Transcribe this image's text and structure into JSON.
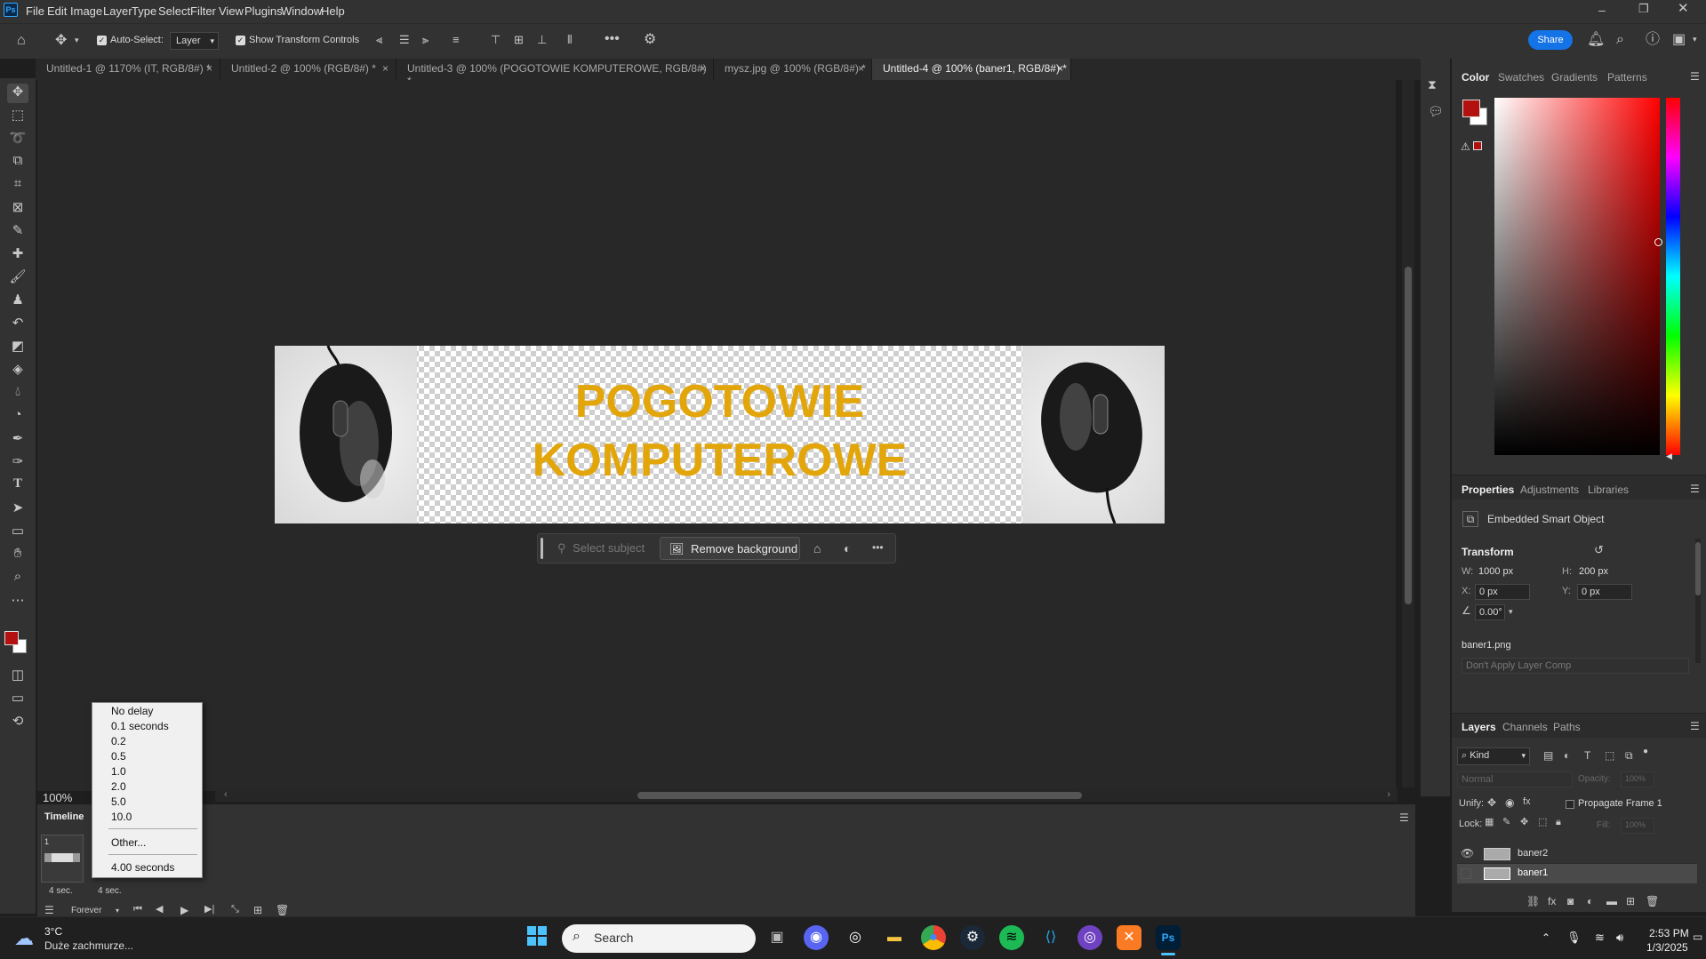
{
  "menu": {
    "ps_logo": "Ps",
    "items": [
      "File",
      "Edit",
      "Image",
      "Layer",
      "Type",
      "Select",
      "Filter",
      "View",
      "Plugins",
      "Window",
      "Help"
    ]
  },
  "options_bar": {
    "auto_select_label": "Auto-Select:",
    "auto_select_value": "Layer",
    "transform_controls_label": "Show Transform Controls",
    "share_label": "Share"
  },
  "tabs": [
    "Untitled-1 @ 1170% (IT, RGB/8#) *",
    "Untitled-2 @ 100% (RGB/8#) *",
    "Untitled-3 @ 100% (POGOTOWIE KOMPUTEROWE, RGB/8#) *",
    "mysz.jpg @ 100% (RGB/8#) *",
    "Untitled-4 @ 100% (baner1, RGB/8#) *"
  ],
  "canvas": {
    "banner_line1": "POGOTOWIE",
    "banner_line2": "KOMPUTEROWE",
    "zoom": "100%"
  },
  "contextual_bar": {
    "select_subject": "Select subject",
    "remove_background": "Remove background"
  },
  "color_panel": {
    "tabs": [
      "Color",
      "Swatches",
      "Gradients",
      "Patterns"
    ],
    "foreground": "#b31010",
    "background": "#ffffff"
  },
  "properties": {
    "tabs": [
      "Properties",
      "Adjustments",
      "Libraries"
    ],
    "object_type": "Embedded Smart Object",
    "transform_label": "Transform",
    "w_label": "W:",
    "w_value": "1000 px",
    "h_label": "H:",
    "h_value": "200 px",
    "x_label": "X:",
    "x_value": "0 px",
    "y_label": "Y:",
    "y_value": "0 px",
    "angle_value": "0.00°",
    "filename": "baner1.png",
    "layer_comp": "Don't Apply Layer Comp"
  },
  "layers": {
    "tabs": [
      "Layers",
      "Channels",
      "Paths"
    ],
    "kind_label": "Kind",
    "blend_mode": "Normal",
    "opacity_label": "Opacity:",
    "opacity_value": "100%",
    "unify_label": "Unify:",
    "propagate_label": "Propagate Frame 1",
    "lock_label": "Lock:",
    "fill_label": "Fill:",
    "fill_value": "100%",
    "items": [
      {
        "name": "baner2",
        "visible": true
      },
      {
        "name": "baner1",
        "visible": false
      }
    ]
  },
  "timeline": {
    "title": "Timeline",
    "frame_number": "1",
    "frame_delay": "4 sec.",
    "frame_delay2": "4 sec.",
    "loop": "Forever"
  },
  "delay_menu": {
    "options": [
      "No delay",
      "0.1 seconds",
      "0.2",
      "0.5",
      "1.0",
      "2.0",
      "5.0",
      "10.0"
    ],
    "other": "Other...",
    "current": "4.00 seconds"
  },
  "taskbar": {
    "weather_temp": "3°C",
    "weather_desc": "Duże zachmurze...",
    "search_placeholder": "Search",
    "time": "2:53 PM",
    "date": "1/3/2025"
  }
}
